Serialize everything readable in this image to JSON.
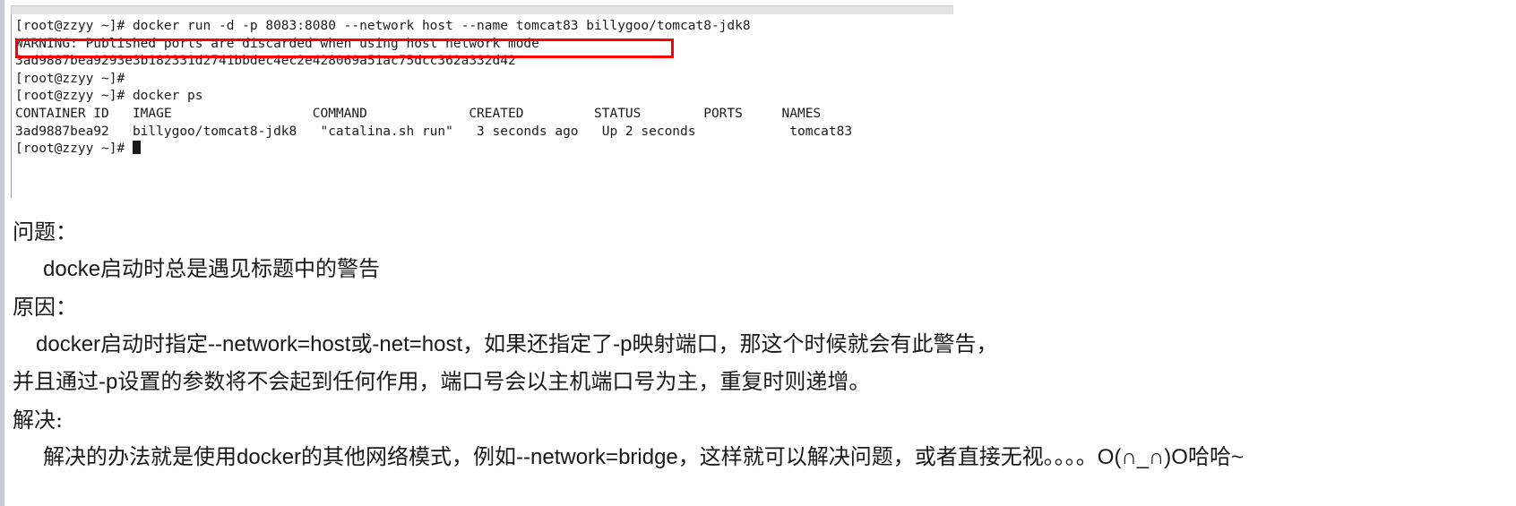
{
  "terminal": {
    "lines": [
      {
        "id": "cmd-docker-run",
        "text": "[root@zzyy ~]# docker run -d -p 8083:8080 --network host --name tomcat83 billygoo/tomcat8-jdk8"
      },
      {
        "id": "warning",
        "text": "WARNING: Published ports are discarded when using host network mode"
      },
      {
        "id": "container-hash",
        "text": "3ad9887bea9293e3b182331d2741bbdec4ec2e428069a51ac75dcc362a332d42"
      },
      {
        "id": "prompt-empty",
        "text": "[root@zzyy ~]#"
      },
      {
        "id": "cmd-docker-ps",
        "text": "[root@zzyy ~]# docker ps"
      },
      {
        "id": "ps-header",
        "text": "CONTAINER ID   IMAGE                  COMMAND             CREATED         STATUS        PORTS     NAMES"
      },
      {
        "id": "ps-row",
        "text": "3ad9887bea92   billygoo/tomcat8-jdk8   \"catalina.sh run\"   3 seconds ago   Up 2 seconds            tomcat83"
      },
      {
        "id": "prompt-final",
        "text": "[root@zzyy ~]# "
      }
    ],
    "ps_table": {
      "columns": [
        "CONTAINER ID",
        "IMAGE",
        "COMMAND",
        "CREATED",
        "STATUS",
        "PORTS",
        "NAMES"
      ],
      "rows": [
        {
          "container_id": "3ad9887bea92",
          "image": "billygoo/tomcat8-jdk8",
          "command": "\"catalina.sh run\"",
          "created": "3 seconds ago",
          "status": "Up 2 seconds",
          "ports": "",
          "names": "tomcat83"
        }
      ]
    },
    "highlight_color": "#ff0000",
    "highlighted_line": "WARNING: Published ports are discarded when using host network mode"
  },
  "prose": {
    "problem_heading": "问题：",
    "problem_text": "docke启动时总是遇见标题中的警告",
    "reason_heading": "原因：",
    "reason_line_1": "docker启动时指定--network=host或-net=host，如果还指定了-p映射端口，那这个时候就会有此警告，",
    "reason_line_2": "并且通过-p设置的参数将不会起到任何作用，端口号会以主机端口号为主，重复时则递增。",
    "solution_heading": "解决:",
    "solution_text": "解决的办法就是使用docker的其他网络模式，例如--network=bridge，这样就可以解决问题，或者直接无视。。。。O(∩_∩)O哈哈~"
  }
}
